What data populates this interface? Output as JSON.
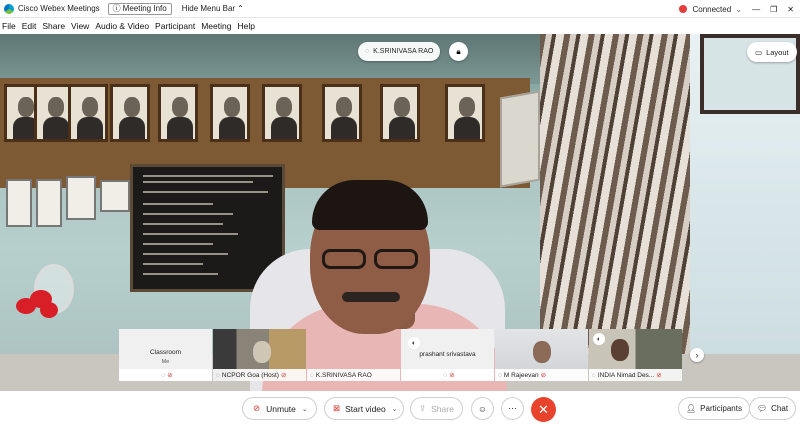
{
  "titlebar": {
    "app_title": "Cisco Webex Meetings",
    "meeting_info_label": "Meeting Info",
    "hide_menu_label": "Hide Menu Bar",
    "status": "Connected"
  },
  "menu": [
    "File",
    "Edit",
    "Share",
    "View",
    "Audio & Video",
    "Participant",
    "Meeting",
    "Help"
  ],
  "stage": {
    "active_speaker": "K.SRINIVASA RAO",
    "layout_label": "Layout"
  },
  "filmstrip": [
    {
      "name": "Classroom",
      "sub": "Me",
      "kind": "avatar"
    },
    {
      "name": "NCPOR Goa (Host)",
      "kind": "video"
    },
    {
      "name": "K.SRINIVASA RAO",
      "kind": "video"
    },
    {
      "name": "prashant srivastava",
      "kind": "avatar"
    },
    {
      "name": "M Rajeevan",
      "kind": "video"
    },
    {
      "name": "INDIA Nimad Des...",
      "kind": "video"
    }
  ],
  "controls": {
    "unmute_label": "Unmute",
    "start_video_label": "Start video",
    "share_label": "Share",
    "participants_label": "Participants",
    "chat_label": "Chat"
  },
  "colors": {
    "leave_red": "#e8432c",
    "status_red": "#e23c3c"
  }
}
